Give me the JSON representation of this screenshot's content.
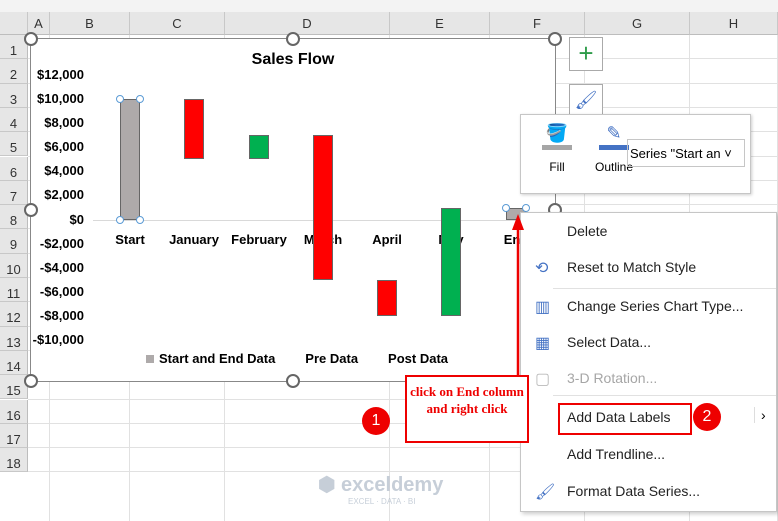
{
  "columns": [
    "A",
    "B",
    "C",
    "D",
    "E",
    "F",
    "G",
    "H"
  ],
  "rows": [
    "1",
    "2",
    "3",
    "4",
    "5",
    "6",
    "7",
    "8",
    "9",
    "10",
    "11",
    "12",
    "13",
    "14",
    "15",
    "16",
    "17",
    "18"
  ],
  "chart_data": {
    "type": "bar",
    "title": "Sales Flow",
    "categories": [
      "Start",
      "January",
      "February",
      "March",
      "April",
      "May",
      "End"
    ],
    "series": [
      {
        "name": "Start and End Data",
        "color": "#aeaaaa",
        "ranges": [
          [
            0,
            10000
          ],
          null,
          null,
          null,
          null,
          null,
          [
            0,
            1000
          ]
        ]
      },
      {
        "name": "Pre Data",
        "color": "#ff0000",
        "ranges": [
          null,
          [
            5000,
            10000
          ],
          null,
          [
            -5000,
            7000
          ],
          [
            -8000,
            -5000
          ],
          null,
          null
        ]
      },
      {
        "name": "Post Data",
        "color": "#00b050",
        "ranges": [
          null,
          null,
          [
            5000,
            7000
          ],
          null,
          null,
          [
            -8000,
            1000
          ],
          null
        ]
      }
    ],
    "yticks": [
      "$12,000",
      "$10,000",
      "$8,000",
      "$6,000",
      "$4,000",
      "$2,000",
      "$0",
      "-$2,000",
      "-$4,000",
      "-$6,000",
      "-$8,000",
      "-$10,000"
    ],
    "ylim": [
      -10000,
      12000
    ],
    "legend": [
      "Start and End Data",
      "Pre Data",
      "Post Data"
    ],
    "legend_position": "bottom"
  },
  "format_bar": {
    "fill": "Fill",
    "outline": "Outline",
    "series_select": "Series \"Start an"
  },
  "menu": {
    "items": [
      "Delete",
      "Reset to Match Style",
      "Change Series Chart Type...",
      "Select Data...",
      "3-D Rotation...",
      "Add Data Labels",
      "Add Trendline...",
      "Format Data Series..."
    ]
  },
  "annotation": {
    "text": "click on End column and right click",
    "step1": "1",
    "step2": "2"
  },
  "watermark": {
    "name": "exceldemy",
    "tag": "EXCEL · DATA · BI"
  }
}
